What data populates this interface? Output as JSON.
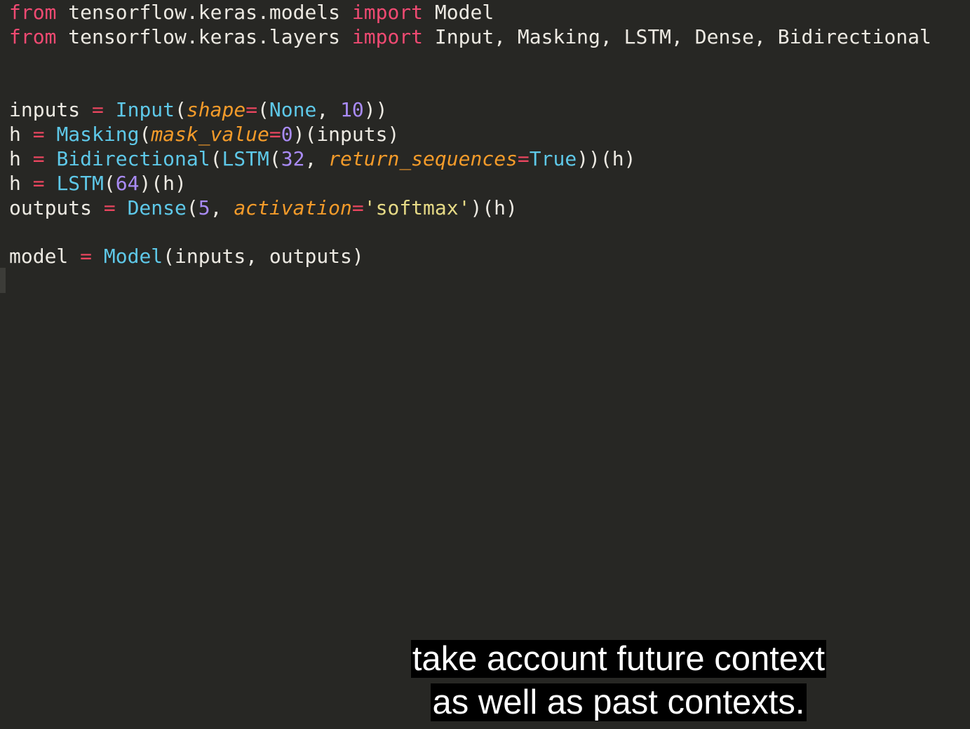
{
  "editor": {
    "lines": [
      [
        {
          "text": "from",
          "kind": "keyword"
        },
        {
          "text": " tensorflow.keras.models ",
          "kind": "plain"
        },
        {
          "text": "import",
          "kind": "keyword"
        },
        {
          "text": " Model",
          "kind": "plain"
        }
      ],
      [
        {
          "text": "from",
          "kind": "keyword"
        },
        {
          "text": " tensorflow.keras.layers ",
          "kind": "plain"
        },
        {
          "text": "import",
          "kind": "keyword"
        },
        {
          "text": " Input, Masking, LSTM, Dense, Bidirectional",
          "kind": "plain"
        }
      ],
      [],
      [],
      [
        {
          "text": "inputs ",
          "kind": "plain"
        },
        {
          "text": "=",
          "kind": "op"
        },
        {
          "text": " ",
          "kind": "plain"
        },
        {
          "text": "Input",
          "kind": "func"
        },
        {
          "text": "(",
          "kind": "plain"
        },
        {
          "text": "shape",
          "kind": "param"
        },
        {
          "text": "=",
          "kind": "op"
        },
        {
          "text": "(",
          "kind": "plain"
        },
        {
          "text": "None",
          "kind": "func"
        },
        {
          "text": ", ",
          "kind": "plain"
        },
        {
          "text": "10",
          "kind": "const"
        },
        {
          "text": "))",
          "kind": "plain"
        }
      ],
      [
        {
          "text": "h ",
          "kind": "plain"
        },
        {
          "text": "=",
          "kind": "op"
        },
        {
          "text": " ",
          "kind": "plain"
        },
        {
          "text": "Masking",
          "kind": "func"
        },
        {
          "text": "(",
          "kind": "plain"
        },
        {
          "text": "mask_value",
          "kind": "param"
        },
        {
          "text": "=",
          "kind": "op"
        },
        {
          "text": "0",
          "kind": "const"
        },
        {
          "text": ")(inputs)",
          "kind": "plain"
        }
      ],
      [
        {
          "text": "h ",
          "kind": "plain"
        },
        {
          "text": "=",
          "kind": "op"
        },
        {
          "text": " ",
          "kind": "plain"
        },
        {
          "text": "Bidirectional",
          "kind": "func"
        },
        {
          "text": "(",
          "kind": "plain"
        },
        {
          "text": "LSTM",
          "kind": "func"
        },
        {
          "text": "(",
          "kind": "plain"
        },
        {
          "text": "32",
          "kind": "const"
        },
        {
          "text": ", ",
          "kind": "plain"
        },
        {
          "text": "return_sequences",
          "kind": "param"
        },
        {
          "text": "=",
          "kind": "op"
        },
        {
          "text": "True",
          "kind": "func"
        },
        {
          "text": "))(h)",
          "kind": "plain"
        }
      ],
      [
        {
          "text": "h ",
          "kind": "plain"
        },
        {
          "text": "=",
          "kind": "op"
        },
        {
          "text": " ",
          "kind": "plain"
        },
        {
          "text": "LSTM",
          "kind": "func"
        },
        {
          "text": "(",
          "kind": "plain"
        },
        {
          "text": "64",
          "kind": "const"
        },
        {
          "text": ")(h)",
          "kind": "plain"
        }
      ],
      [
        {
          "text": "outputs ",
          "kind": "plain"
        },
        {
          "text": "=",
          "kind": "op"
        },
        {
          "text": " ",
          "kind": "plain"
        },
        {
          "text": "Dense",
          "kind": "func"
        },
        {
          "text": "(",
          "kind": "plain"
        },
        {
          "text": "5",
          "kind": "const"
        },
        {
          "text": ", ",
          "kind": "plain"
        },
        {
          "text": "activation",
          "kind": "param"
        },
        {
          "text": "=",
          "kind": "op"
        },
        {
          "text": "'softmax'",
          "kind": "string"
        },
        {
          "text": ")(h)",
          "kind": "plain"
        }
      ],
      [],
      [
        {
          "text": "model ",
          "kind": "plain"
        },
        {
          "text": "=",
          "kind": "op"
        },
        {
          "text": " ",
          "kind": "plain"
        },
        {
          "text": "Model",
          "kind": "func"
        },
        {
          "text": "(inputs, outputs)",
          "kind": "plain"
        }
      ]
    ]
  },
  "subtitles": {
    "line1": "take account future context",
    "line2": "as well as past contexts."
  }
}
